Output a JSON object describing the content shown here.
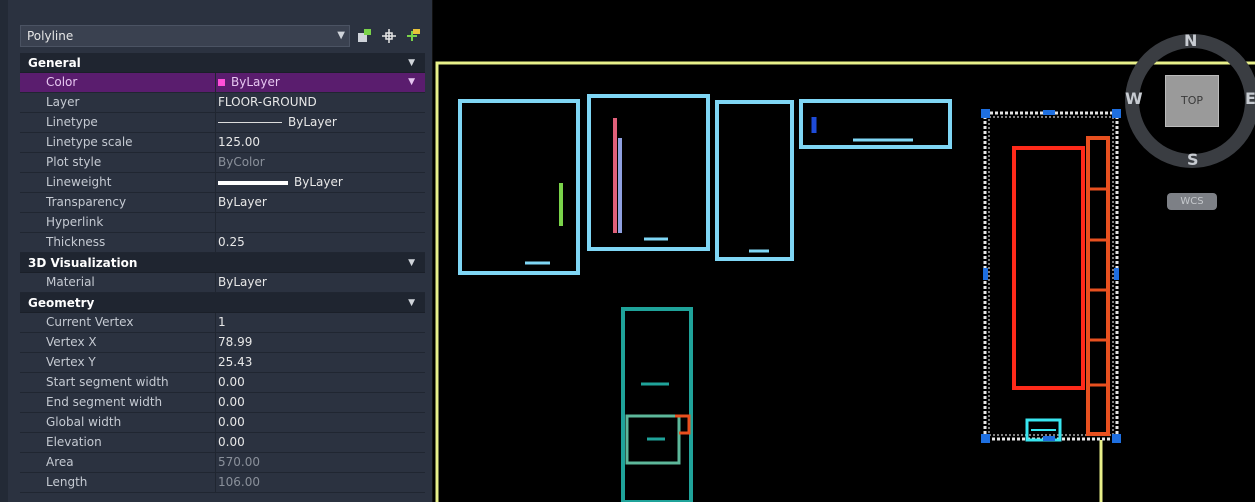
{
  "palette": {
    "selector_value": "Polyline",
    "sections": {
      "general": "General",
      "visualization": "3D Visualization",
      "geometry": "Geometry"
    },
    "general": {
      "color": {
        "label": "Color",
        "value": "ByLayer"
      },
      "layer": {
        "label": "Layer",
        "value": "FLOOR-GROUND"
      },
      "linetype": {
        "label": "Linetype",
        "value": "ByLayer"
      },
      "linetype_scale": {
        "label": "Linetype scale",
        "value": "125.00"
      },
      "plot_style": {
        "label": "Plot style",
        "value": "ByColor"
      },
      "lineweight": {
        "label": "Lineweight",
        "value": "ByLayer"
      },
      "transparency": {
        "label": "Transparency",
        "value": "ByLayer"
      },
      "hyperlink": {
        "label": "Hyperlink",
        "value": ""
      },
      "thickness": {
        "label": "Thickness",
        "value": "0.25"
      }
    },
    "visualization": {
      "material": {
        "label": "Material",
        "value": "ByLayer"
      }
    },
    "geometry": {
      "current_vertex": {
        "label": "Current Vertex",
        "value": "1"
      },
      "vertex_x": {
        "label": "Vertex X",
        "value": "78.99"
      },
      "vertex_y": {
        "label": "Vertex Y",
        "value": "25.43"
      },
      "start_width": {
        "label": "Start segment width",
        "value": "0.00"
      },
      "end_width": {
        "label": "End segment width",
        "value": "0.00"
      },
      "global_width": {
        "label": "Global width",
        "value": "0.00"
      },
      "elevation": {
        "label": "Elevation",
        "value": "0.00"
      },
      "area": {
        "label": "Area",
        "value": "570.00"
      },
      "length": {
        "label": "Length",
        "value": "106.00"
      }
    },
    "icons": [
      "quick-select-icon",
      "select-objects-icon",
      "toggle-pickadd-icon"
    ],
    "highlight_color": "#5a1d6e"
  },
  "viewcube": {
    "north": "N",
    "south": "S",
    "west": "W",
    "east": "E",
    "face": "TOP",
    "ucs": "WCS"
  },
  "drawing_colors": {
    "boundary": "#e8f08a",
    "fixtures": "#7fd6f5",
    "selected_frame": "#e6e6e6",
    "shelf_red": "#ff2a1a",
    "shelf_orange": "#e8501f",
    "cabinet_teal": "#1fa39a",
    "grip": "#1e6fe0"
  }
}
